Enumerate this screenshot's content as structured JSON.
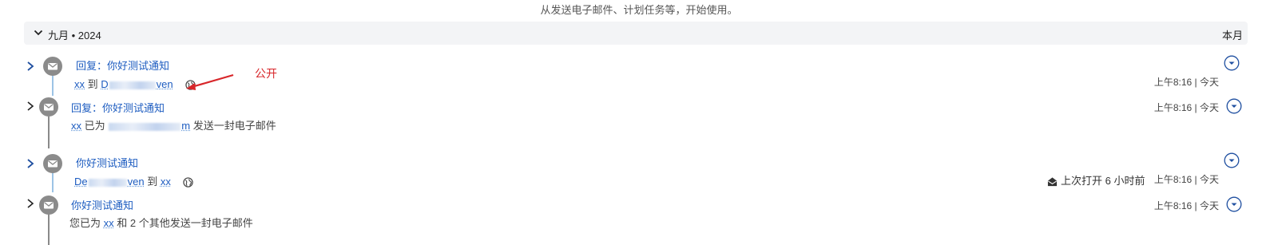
{
  "top_hint": "从发送电子邮件、计划任务等，开始使用。",
  "month_group": {
    "label": "九月 • 2024",
    "right_label": "本月"
  },
  "items": [
    {
      "subject": "回复：你好测试通知",
      "from": "xx",
      "connector": "到",
      "to_tail": "ven",
      "time": "上午8:16 | 今天"
    },
    {
      "subject": "回复：你好测试通知",
      "from": "xx",
      "connector": "已为",
      "email_tail": "m",
      "action": "发送一封电子邮件",
      "time": "上午8:16 | 今天"
    },
    {
      "subject": "你好测试通知",
      "from_head": "De",
      "from_tail": "ven",
      "connector": "到",
      "to": "xx",
      "opened_text": "上次打开 6 小时前",
      "time": "上午8:16 | 今天"
    },
    {
      "subject": "你好测试通知",
      "prefix": "您已为",
      "to": "xx",
      "suffix": "和 2 个其他发送一封电子邮件",
      "time": "上午8:16 | 今天"
    }
  ],
  "annotation": {
    "text": "公开",
    "color": "#d8262a"
  },
  "colors": {
    "link": "#1d5cc0",
    "thread_blue": "#9cc4e6",
    "thread_gray": "#8a8a8a",
    "icon_gray": "#8b8b8b",
    "chevron": "#1f4fa0"
  },
  "icons": [
    "chevron-down-icon",
    "chevron-right-icon",
    "envelope-icon",
    "globe-icon",
    "dropdown-circle-icon",
    "envelope-open-icon"
  ]
}
